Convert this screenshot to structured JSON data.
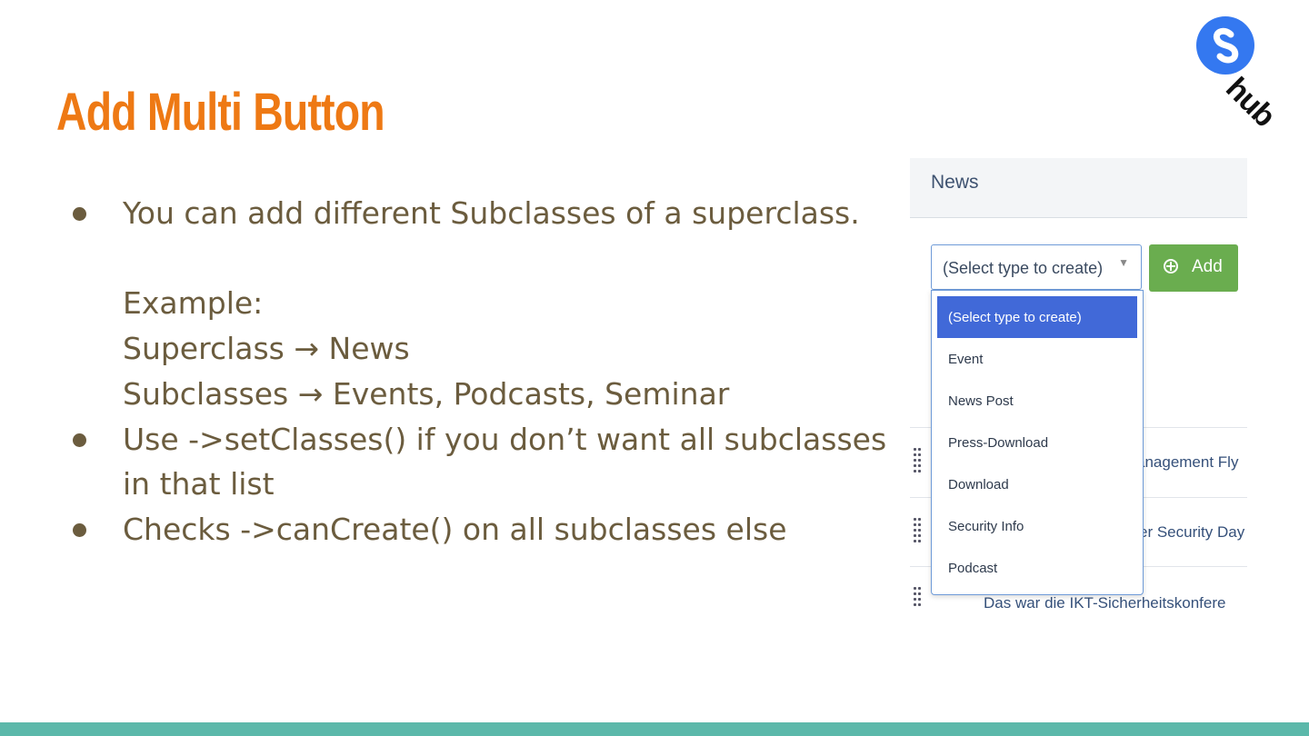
{
  "slide": {
    "title": "Add Multi Button",
    "logo": {
      "text": "hub",
      "icon": "s-circle-logo-icon",
      "circle_color": "#3478f0"
    },
    "bullets": [
      {
        "lines": [
          "You can add different Subclasses of a superclass.",
          "",
          "Example:",
          "Superclass → News",
          "Subclasses → Events, Podcasts, Seminar"
        ]
      },
      {
        "lines": [
          "Use ->setClasses() if you don’t want all subclasses",
          "in that list"
        ]
      },
      {
        "lines": [
          "Checks ->canCreate() on all subclasses else"
        ]
      }
    ],
    "colors": {
      "title": "#ee7914",
      "body_text": "#6b5c3e",
      "bottom_bar": "#5bb8aa"
    }
  },
  "screenshot": {
    "header_title": "News",
    "select": {
      "value": "(Select type to create)",
      "arrow": "▼"
    },
    "add_button": {
      "label": "Add",
      "icon": "plus-circle-icon",
      "color": "#6aad4f"
    },
    "dropdown_options": [
      {
        "label": "(Select type to create)",
        "selected": true
      },
      {
        "label": "Event",
        "selected": false
      },
      {
        "label": "News Post",
        "selected": false
      },
      {
        "label": "Press-Download",
        "selected": false
      },
      {
        "label": "Download",
        "selected": false
      },
      {
        "label": "Security Info",
        "selected": false
      },
      {
        "label": "Podcast",
        "selected": false
      }
    ],
    "rows": [
      {
        "text": "anagement Fly"
      },
      {
        "text": "er Security Day"
      },
      {
        "text": "Das war die IKT-Sicherheitskonfere"
      }
    ]
  }
}
